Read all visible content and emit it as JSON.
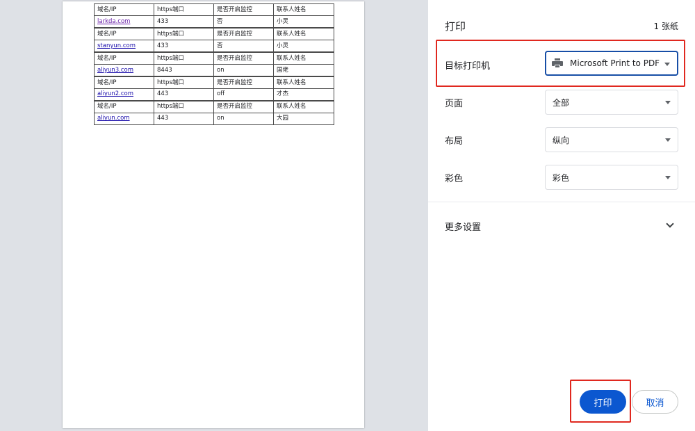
{
  "document": {
    "rows": [
      [
        "域名/IP",
        "https端口",
        "是否开启监控",
        "联系人姓名"
      ],
      [
        "larkda.com",
        "433",
        "否",
        "小灵"
      ],
      [
        "域名/IP",
        "https端口",
        "是否开启监控",
        "联系人姓名"
      ],
      [
        "stanyun.com",
        "433",
        "否",
        "小灵"
      ],
      [
        "域名/IP",
        "https端口",
        "是否开启监控",
        "联系人姓名"
      ],
      [
        "aliyun3.com",
        "8443",
        "on",
        "国佬"
      ],
      [
        "域名/IP",
        "https端口",
        "是否开启监控",
        "联系人姓名"
      ],
      [
        "aliyun2.com",
        "443",
        "off",
        "才杰"
      ],
      [
        "域名/IP",
        "https端口",
        "是否开启监控",
        "联系人姓名"
      ],
      [
        "aliyun.com",
        "443",
        "on",
        "大园"
      ]
    ]
  },
  "panel": {
    "title": "打印",
    "sheet_count": "1 张纸",
    "destination_label": "目标打印机",
    "destination_value": "Microsoft Print to PDF",
    "pages_label": "页面",
    "pages_value": "全部",
    "layout_label": "布局",
    "layout_value": "纵向",
    "color_label": "彩色",
    "color_value": "彩色",
    "more_settings": "更多设置",
    "print_button": "打印",
    "cancel_button": "取消"
  },
  "colors": {
    "accent": "#0b57d0",
    "highlight": "#e0281f",
    "preview_bg": "#dee1e6"
  }
}
